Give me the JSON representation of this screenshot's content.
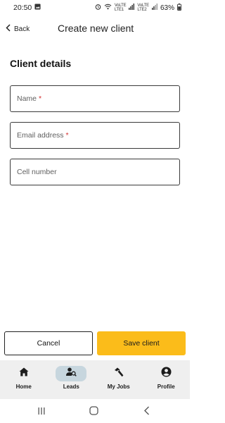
{
  "status_bar": {
    "time": "20:50",
    "net1_top": "VoLTE",
    "net1_bottom": "LTE1",
    "net2_top": "VoLTE",
    "net2_bottom": "LTE2",
    "battery": "63%"
  },
  "app_bar": {
    "back_label": "Back",
    "title": "Create new client"
  },
  "form": {
    "heading": "Client details",
    "name_label": "Name",
    "email_label": "Email address",
    "cell_label": "Cell number",
    "required_marker": "*"
  },
  "actions": {
    "cancel_label": "Cancel",
    "save_label": "Save client",
    "save_color": "#fbbc1a"
  },
  "bottom_nav": {
    "items": [
      {
        "label": "Home",
        "icon": "home-icon"
      },
      {
        "label": "Leads",
        "icon": "person-search-icon",
        "active": true
      },
      {
        "label": "My Jobs",
        "icon": "hammer-icon"
      },
      {
        "label": "Profile",
        "icon": "account-circle-icon"
      }
    ],
    "active_color": "#c7d6de"
  }
}
